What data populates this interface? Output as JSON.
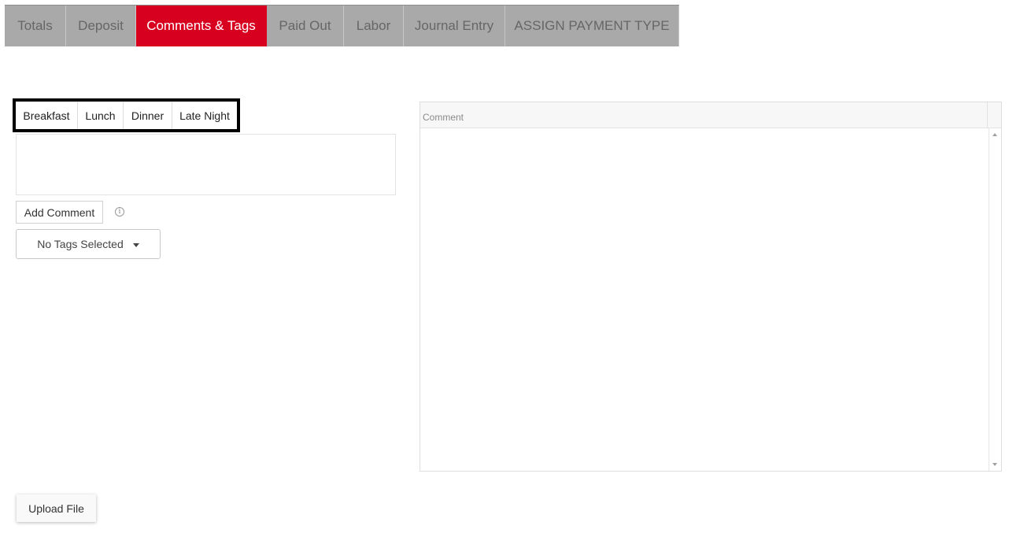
{
  "tabs": [
    {
      "label": "Totals"
    },
    {
      "label": "Deposit"
    },
    {
      "label": "Comments & Tags",
      "active": true
    },
    {
      "label": "Paid Out"
    },
    {
      "label": "Labor"
    },
    {
      "label": "Journal Entry"
    },
    {
      "label": "ASSIGN PAYMENT TYPE"
    }
  ],
  "meal_periods": [
    "Breakfast",
    "Lunch",
    "Dinner",
    "Late Night"
  ],
  "comment": {
    "value": "",
    "add_label": "Add Comment",
    "info_glyph": "i"
  },
  "tags": {
    "selected_label": "No Tags Selected"
  },
  "grid": {
    "columns": [
      "Comment"
    ],
    "rows": []
  },
  "upload_label": "Upload File",
  "colors": {
    "accent": "#d7001f",
    "tab_bg": "#a9a9a9",
    "tab_text": "#666666"
  },
  "icons": {
    "info": "info-icon",
    "dropdown": "caret-down-icon",
    "scroll_up": "scroll-up-arrow-icon",
    "scroll_down": "scroll-down-arrow-icon"
  }
}
